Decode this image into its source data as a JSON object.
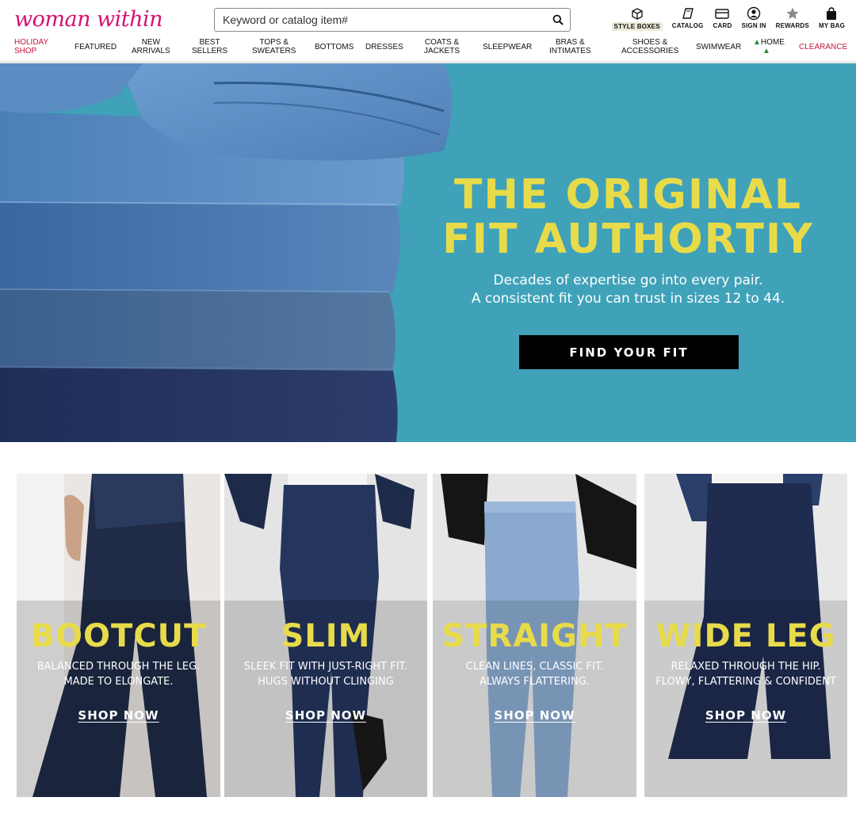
{
  "brand": {
    "logo_text": "woman within",
    "accent": "#d6116f"
  },
  "search": {
    "placeholder": "Keyword or catalog item#",
    "icon": "search-icon"
  },
  "utilities": [
    {
      "label": "STYLE BOXES",
      "icon": "box-icon"
    },
    {
      "label": "CATALOG",
      "icon": "catalog-icon"
    },
    {
      "label": "CARD",
      "icon": "card-icon"
    },
    {
      "label": "SIGN IN",
      "icon": "user-icon"
    },
    {
      "label": "REWARDS",
      "icon": "star-icon"
    },
    {
      "label": "MY BAG",
      "icon": "bag-icon"
    }
  ],
  "nav": [
    {
      "label": "HOLIDAY\nSHOP"
    },
    {
      "label": "FEATURED"
    },
    {
      "label": "NEW\nARRIVALS"
    },
    {
      "label": "BEST\nSELLERS"
    },
    {
      "label": "TOPS &\nSWEATERS"
    },
    {
      "label": "BOTTOMS"
    },
    {
      "label": "DRESSES"
    },
    {
      "label": "COATS &\nJACKETS"
    },
    {
      "label": "SLEEPWEAR"
    },
    {
      "label": "BRAS &\nINTIMATES"
    },
    {
      "label": "SHOES &\nACCESSORIES"
    },
    {
      "label": "SWIMWEAR"
    },
    {
      "label": "HOME"
    },
    {
      "label": "CLEARANCE"
    }
  ],
  "hero": {
    "title_line1": "THE ORIGINAL",
    "title_line2": "FIT AUTHORTIY",
    "subtitle_line1": "Decades of expertise go into every pair.",
    "subtitle_line2": "A consistent fit you can trust in sizes 12 to 44.",
    "cta": "FIND YOUR FIT",
    "bg_color": "#3fa2b9",
    "title_color": "#e8db4a"
  },
  "cards": [
    {
      "title": "BOOTCUT",
      "desc_line1": "BALANCED THROUGH THE LEG.",
      "desc_line2": "MADE TO ELONGATE.",
      "cta": "SHOP NOW"
    },
    {
      "title": "SLIM",
      "desc_line1": "SLEEK FIT WITH JUST-RIGHT FIT.",
      "desc_line2": "HUGS WITHOUT CLINGING",
      "cta": "SHOP NOW"
    },
    {
      "title": "STRAIGHT",
      "desc_line1": "CLEAN LINES, CLASSIC FIT.",
      "desc_line2": "ALWAYS FLATTERING.",
      "cta": "SHOP NOW"
    },
    {
      "title": "WIDE LEG",
      "desc_line1": "RELAXED THROUGH THE HIP.",
      "desc_line2": "FLOWY, FLATTERING & CONFIDENT",
      "cta": "SHOP NOW"
    }
  ]
}
